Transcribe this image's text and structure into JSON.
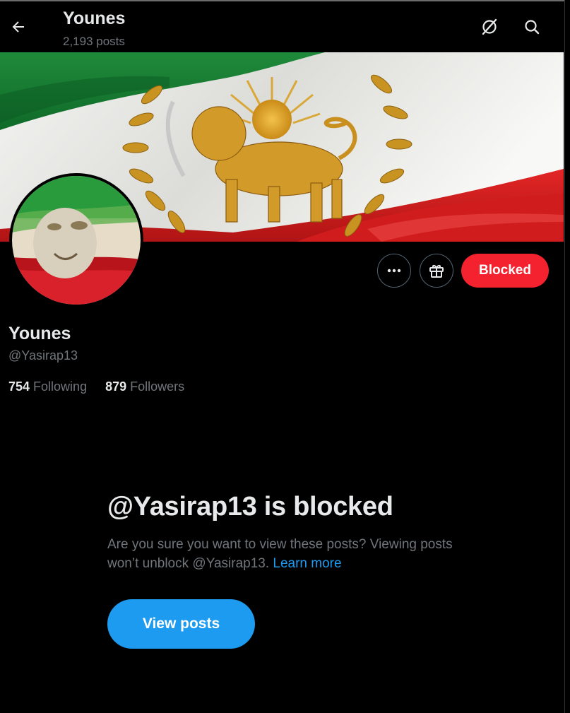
{
  "header": {
    "title": "Younes",
    "posts_count": "2,193 posts",
    "back_icon": "arrow-left-icon",
    "grok_icon": "grok-icon",
    "search_icon": "search-icon"
  },
  "banner": {
    "description_icon": "lion-and-sun-flag-banner"
  },
  "avatar": {
    "icon": "lion-flag-avatar"
  },
  "actions": {
    "more_icon": "more-icon",
    "gift_icon": "gift-icon",
    "blocked_label": "Blocked",
    "blocked_color": "#f4212e"
  },
  "profile": {
    "name": "Younes",
    "handle": "@Yasirap13",
    "following_count": "754",
    "following_label": "Following",
    "followers_count": "879",
    "followers_label": "Followers"
  },
  "notice": {
    "title": "@Yasirap13 is blocked",
    "description": "Are you sure you want to view these posts? Viewing posts won’t unblock @Yasirap13.",
    "learn_more": "Learn more",
    "view_posts_label": "View posts",
    "accent_color": "#1d9bf0"
  }
}
